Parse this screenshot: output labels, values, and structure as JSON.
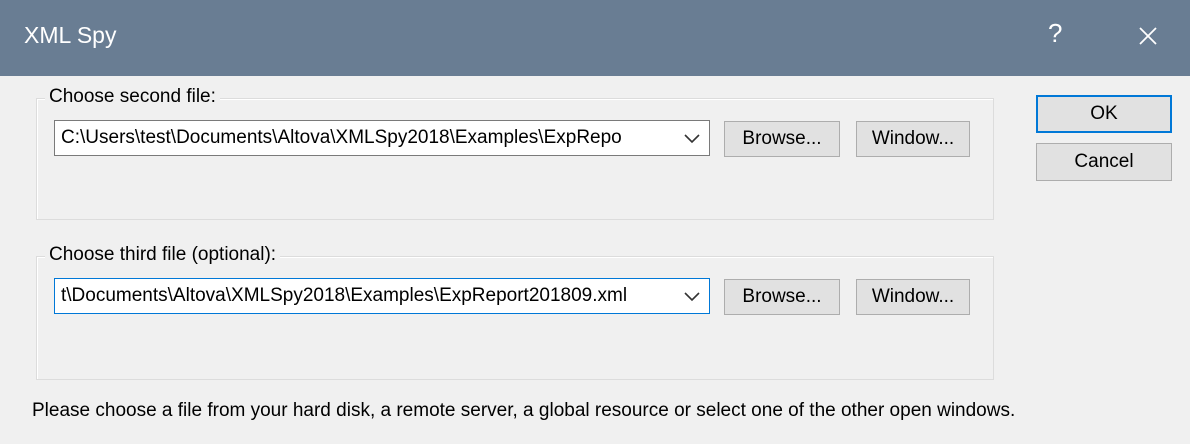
{
  "window": {
    "title": "XML Spy",
    "help_label": "?",
    "close_icon": "close-icon"
  },
  "second_file": {
    "group_label": "Choose second file:",
    "value": "C:\\Users\\test\\Documents\\Altova\\XMLSpy2018\\Examples\\ExpRepo",
    "browse_label": "Browse...",
    "window_label": "Window..."
  },
  "third_file": {
    "group_label": "Choose third file (optional):",
    "value": "t\\Documents\\Altova\\XMLSpy2018\\Examples\\ExpReport201809.xml",
    "browse_label": "Browse...",
    "window_label": "Window..."
  },
  "actions": {
    "ok_label": "OK",
    "cancel_label": "Cancel"
  },
  "hint_text": "Please choose a file from your hard disk, a remote server, a global resource or select one of the other open windows.",
  "colors": {
    "titlebar": "#697d93",
    "focus": "#0078d7"
  }
}
